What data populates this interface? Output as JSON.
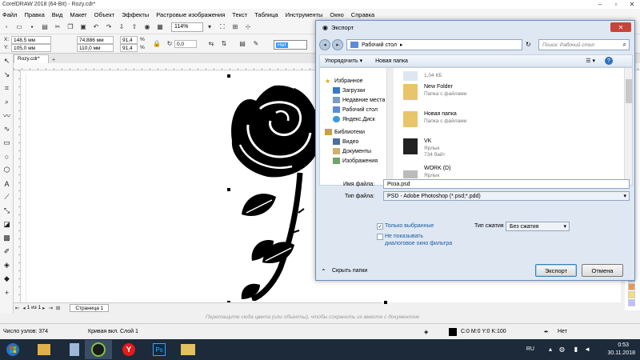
{
  "app": {
    "title": "CorelDRAW 2018 (64-Bit) - Rozy.cdr*",
    "menu": [
      "Файл",
      "Правка",
      "Вид",
      "Макет",
      "Объект",
      "Эффекты",
      "Растровые изображения",
      "Текст",
      "Таблица",
      "Инструменты",
      "Окно",
      "Справка"
    ],
    "zoom": "114%",
    "x_value": "148,5 мм",
    "y_value": "105,0 мм",
    "w_value": "74,886 мм",
    "h_value": "110,0 мм",
    "sx_value": "91,4",
    "sy_value": "91,4",
    "percent": "%",
    "angle": "0,0",
    "nib_value": "Нет",
    "doc_tab": "Rozy.cdr*",
    "page_counter": "1 из 1",
    "page_tab": "Страница 1",
    "hint": "Перетащите сюда цвета (или объекты), чтобы сохранить их вместе с документом",
    "status_nodes": "Число узлов: 374",
    "status_layer": "Кривая вкл. Слой 1",
    "status_fill": "C:0 M:0 Y:0 K:100",
    "status_outline": "Нет"
  },
  "taskbar": {
    "lang": "RU",
    "time": "0:53",
    "date": "30.11.2018"
  },
  "dialog": {
    "title": "Экспорт",
    "address": "Рабочий стол",
    "search_placeholder": "Поиск: Рабочий стол",
    "organize": "Упорядочить ▾",
    "new_folder": "Новая папка",
    "nav": {
      "favorites": "Избранное",
      "downloads": "Загрузки",
      "recent": "Недавние места",
      "desktop": "Рабочий стол",
      "yandex": "Яндекс.Диск",
      "libraries": "Библиотеки",
      "video": "Видео",
      "documents": "Документы",
      "images": "Изображения"
    },
    "files": [
      {
        "name": "",
        "sub": "1,04 КБ",
        "sub2": ""
      },
      {
        "name": "New Folder",
        "sub": "Папка с файлами",
        "sub2": ""
      },
      {
        "name": "Новая папка",
        "sub": "Папка с файлами",
        "sub2": ""
      },
      {
        "name": "VK",
        "sub": "Ярлык",
        "sub2": "734 байт"
      },
      {
        "name": "WORK (D)",
        "sub": "Ярлык",
        "sub2": ""
      }
    ],
    "filename_label": "Имя файла:",
    "filename": "Роза.psd",
    "filetype_label": "Тип файла:",
    "filetype": "PSD - Adobe Photoshop (*.psd;*.pdd)",
    "only_selected": "Только выбранные",
    "no_filter_dialog_1": "Не показывать",
    "no_filter_dialog_2": "диалоговое окно фильтра",
    "compression_label": "Тип сжатия",
    "compression": "Без сжатия",
    "hide_folders": "Скрыть папки",
    "export_btn": "Экспорт",
    "cancel_btn": "Отмена"
  }
}
